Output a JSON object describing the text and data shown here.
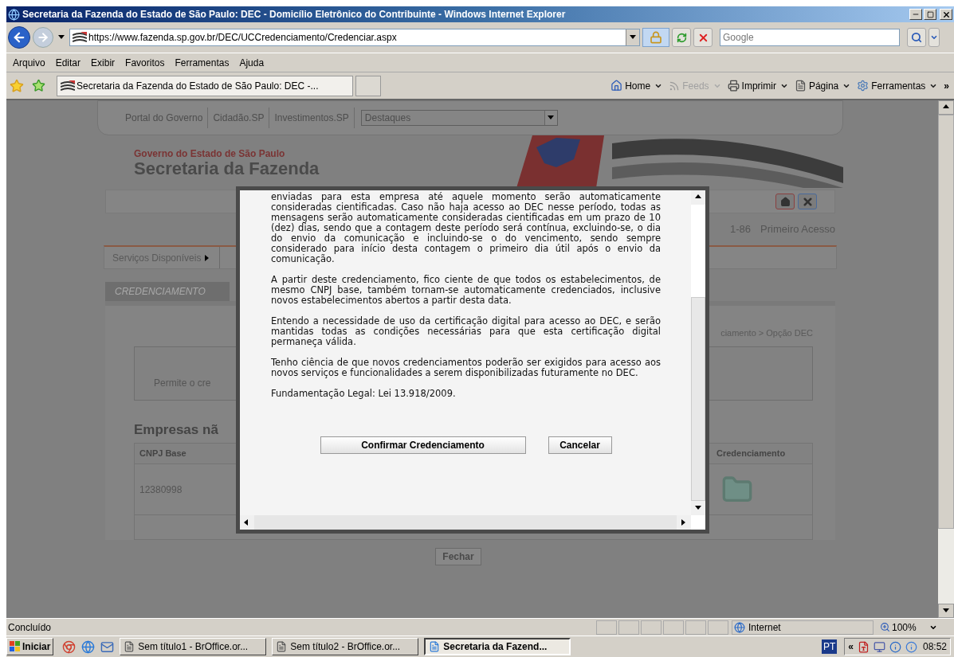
{
  "window": {
    "title": "Secretaria da Fazenda do Estado de São Paulo: DEC - Domicílio Eletrônico do Contribuinte - Windows Internet Explorer"
  },
  "address_bar": {
    "url": "https://www.fazenda.sp.gov.br/DEC/UCCredenciamento/Credenciar.aspx",
    "search": {
      "placeholder": "Google"
    }
  },
  "menu": [
    "Arquivo",
    "Editar",
    "Exibir",
    "Favoritos",
    "Ferramentas",
    "Ajuda"
  ],
  "favorites_bar": {
    "tab_title": "Secretaria da Fazenda do Estado de São Paulo: DEC -..."
  },
  "command_bar": {
    "items": [
      {
        "kind": "home",
        "label": "Home",
        "disabled": false
      },
      {
        "kind": "feeds",
        "label": "Feeds",
        "disabled": true
      },
      {
        "kind": "print",
        "label": "Imprimir",
        "disabled": false
      },
      {
        "kind": "page",
        "label": "Página",
        "disabled": false
      },
      {
        "kind": "tools",
        "label": "Ferramentas",
        "disabled": false
      }
    ],
    "more": "»"
  },
  "page": {
    "top_links": [
      "Portal do Governo",
      "Cidadão.SP",
      "Investimentos.SP"
    ],
    "highlights_select": {
      "value": "Destaques"
    },
    "header": {
      "government": "Governo do Estado de São Paulo",
      "department": "Secretaria da Fazenda"
    },
    "user_info": "1-86",
    "first_access": "Primeiro Acesso",
    "services_menu": "Serviços Disponíveis",
    "section_tab": "CREDENCIAMENTO",
    "breadcrumb": "ciamento > Opção DEC",
    "description": "Permite o cre",
    "heading": "Empresas nã",
    "table": {
      "columns": [
        "CNPJ Base",
        "Credenciamento"
      ],
      "rows": [
        {
          "cnpj": "12380998"
        }
      ]
    },
    "close_button": "Fechar"
  },
  "dialog": {
    "paragraphs": [
      "enviadas para esta empresa até aquele momento serão automaticamente consideradas cientificadas. Caso não haja acesso ao DEC nesse período, todas as mensagens serão automaticamente consideradas cientificadas em um prazo de 10 (dez) dias, sendo que a contagem deste período será contínua, excluindo-se, o dia do envio da comunicação e incluindo-se o do vencimento, sendo sempre considerado para início desta contagem o primeiro dia útil após o envio da comunicação.",
      "A partir deste credenciamento, fico ciente de que todos os estabelecimentos, de mesmo CNPJ base, também tornam-se automaticamente credenciados, inclusive novos estabelecimentos abertos a partir desta data.",
      "Entendo a necessidade de uso da certificação digital para acesso ao DEC, e serão mantidas todas as condições necessárias para que esta certificação digital permaneça válida.",
      "Tenho ciência de que novos credenciamentos poderão ser exigidos para acesso aos novos serviços e funcionalidades a serem disponibilizadas futuramente no DEC.",
      "Fundamentação Legal: Lei 13.918/2009."
    ],
    "buttons": [
      "Confirmar Credenciamento",
      "Cancelar"
    ]
  },
  "status_bar": {
    "text": "Concluído",
    "zone": "Internet",
    "zoom": "100%"
  },
  "taskbar": {
    "start": "Iniciar",
    "tasks": [
      {
        "label": "Sem título1 - BrOffice.or...",
        "selected": false
      },
      {
        "label": "Sem título2 - BrOffice.or...",
        "selected": false
      },
      {
        "label": "Secretaria da Fazend...",
        "selected": true
      }
    ],
    "language": "PT",
    "tray_toggle": "«",
    "clock": "08:52"
  }
}
